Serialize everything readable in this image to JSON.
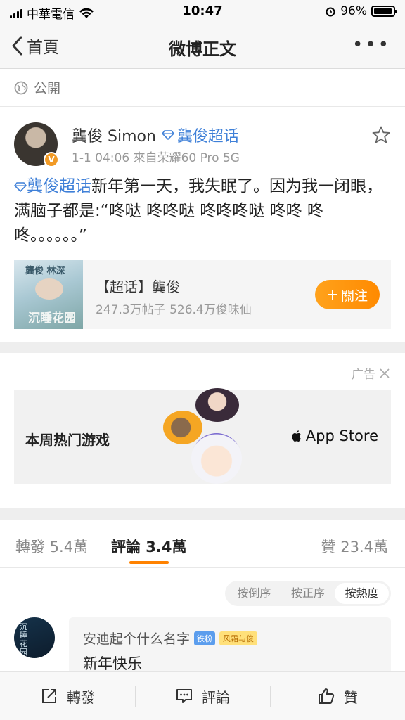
{
  "status_bar": {
    "carrier": "中華電信",
    "time": "10:47",
    "battery": "96%"
  },
  "nav": {
    "back_label": "首頁",
    "title": "微博正文",
    "more": "•••"
  },
  "visibility": {
    "label": "公開"
  },
  "post": {
    "username": "龔俊 Simon",
    "topic": "龔俊超话",
    "meta": "1-1 04:06  來自荣耀60 Pro 5G",
    "text_link": "龔俊超话",
    "text_body": "新年第一天，我失眠了。因为我一闭眼，满脑子都是:“咚哒 咚咚哒 咚咚咚哒 咚咚 咚咚。。。。。。”",
    "topic_card": {
      "thumb_top": "龔俊  林深",
      "thumb_bottom": "沉睡花园",
      "title": "【超话】龔俊",
      "stats": "247.3万帖子 526.4万俊味仙",
      "follow_label": "關注"
    }
  },
  "ad": {
    "label": "广告",
    "text": "本周热门游戏",
    "store": "App Store"
  },
  "tabs": {
    "repost": "轉發 5.4萬",
    "comment": "評論 3.4萬",
    "like": "贊 23.4萬"
  },
  "sort": {
    "options": [
      "按倒序",
      "按正序",
      "按熱度"
    ],
    "active": "按熱度"
  },
  "comment": {
    "avatar_text": "沉睡花园",
    "name": "安迪起个什么名字",
    "badge_fan": "铁粉",
    "badge_level": "风霜与俊",
    "text": "新年快乐"
  },
  "bottom_bar": {
    "repost": "轉發",
    "comment": "評論",
    "like": "贊"
  },
  "colors": {
    "accent": "#ff8200",
    "link": "#3f80d8",
    "follow_btn": "#ff9a14"
  }
}
